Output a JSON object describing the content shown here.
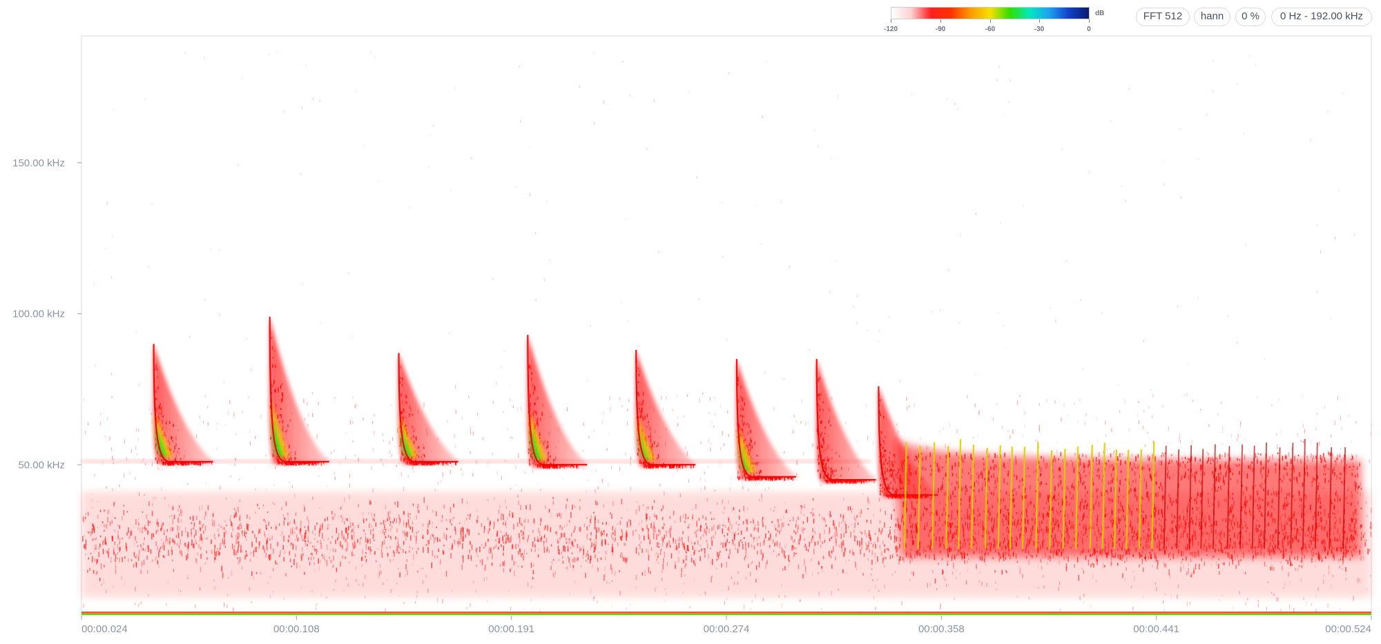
{
  "controls": {
    "fft": "FFT 512",
    "window": "hann",
    "overlap": "0 %",
    "range": "0 Hz - 192.00 kHz"
  },
  "colorbar": {
    "unit": "dB",
    "ticks": [
      "-120",
      "-90",
      "-60",
      "-30",
      "0"
    ],
    "stops": [
      "#ffffff",
      "#ffd0d0",
      "#ff2020",
      "#ff3000",
      "#ff9a00",
      "#f5e000",
      "#30e000",
      "#00e8c0",
      "#1ea0f0",
      "#1040c8",
      "#0a1a70"
    ]
  },
  "chart_data": {
    "type": "heatmap",
    "title": "",
    "xlabel": "",
    "ylabel": "",
    "x_range": [
      0.024,
      0.524
    ],
    "y_range_khz": [
      0,
      192
    ],
    "x_ticks": [
      "00:00.024",
      "00:00.108",
      "00:00.191",
      "00:00.274",
      "00:00.358",
      "00:00.441",
      "00:00.524"
    ],
    "y_ticks": [
      "150.00 kHz",
      "100.00 kHz",
      "50.00 kHz"
    ],
    "y_tick_values": [
      150,
      100,
      50
    ],
    "colormap": "white-red-yellow-green-cyan-blue",
    "background_noise_band_khz": [
      10,
      35
    ],
    "calls": [
      {
        "start_s": 0.052,
        "top_khz": 90,
        "end_khz": 51
      },
      {
        "start_s": 0.097,
        "top_khz": 99,
        "end_khz": 51
      },
      {
        "start_s": 0.147,
        "top_khz": 87,
        "end_khz": 51
      },
      {
        "start_s": 0.197,
        "top_khz": 93,
        "end_khz": 50
      },
      {
        "start_s": 0.239,
        "top_khz": 88,
        "end_khz": 50
      },
      {
        "start_s": 0.278,
        "top_khz": 85,
        "end_khz": 46
      },
      {
        "start_s": 0.309,
        "top_khz": 85,
        "end_khz": 45
      },
      {
        "start_s": 0.333,
        "top_khz": 76,
        "end_khz": 40
      }
    ],
    "buzz": {
      "start_s": 0.339,
      "end_s": 0.52,
      "low_khz": 24,
      "high_khz": 52
    }
  }
}
